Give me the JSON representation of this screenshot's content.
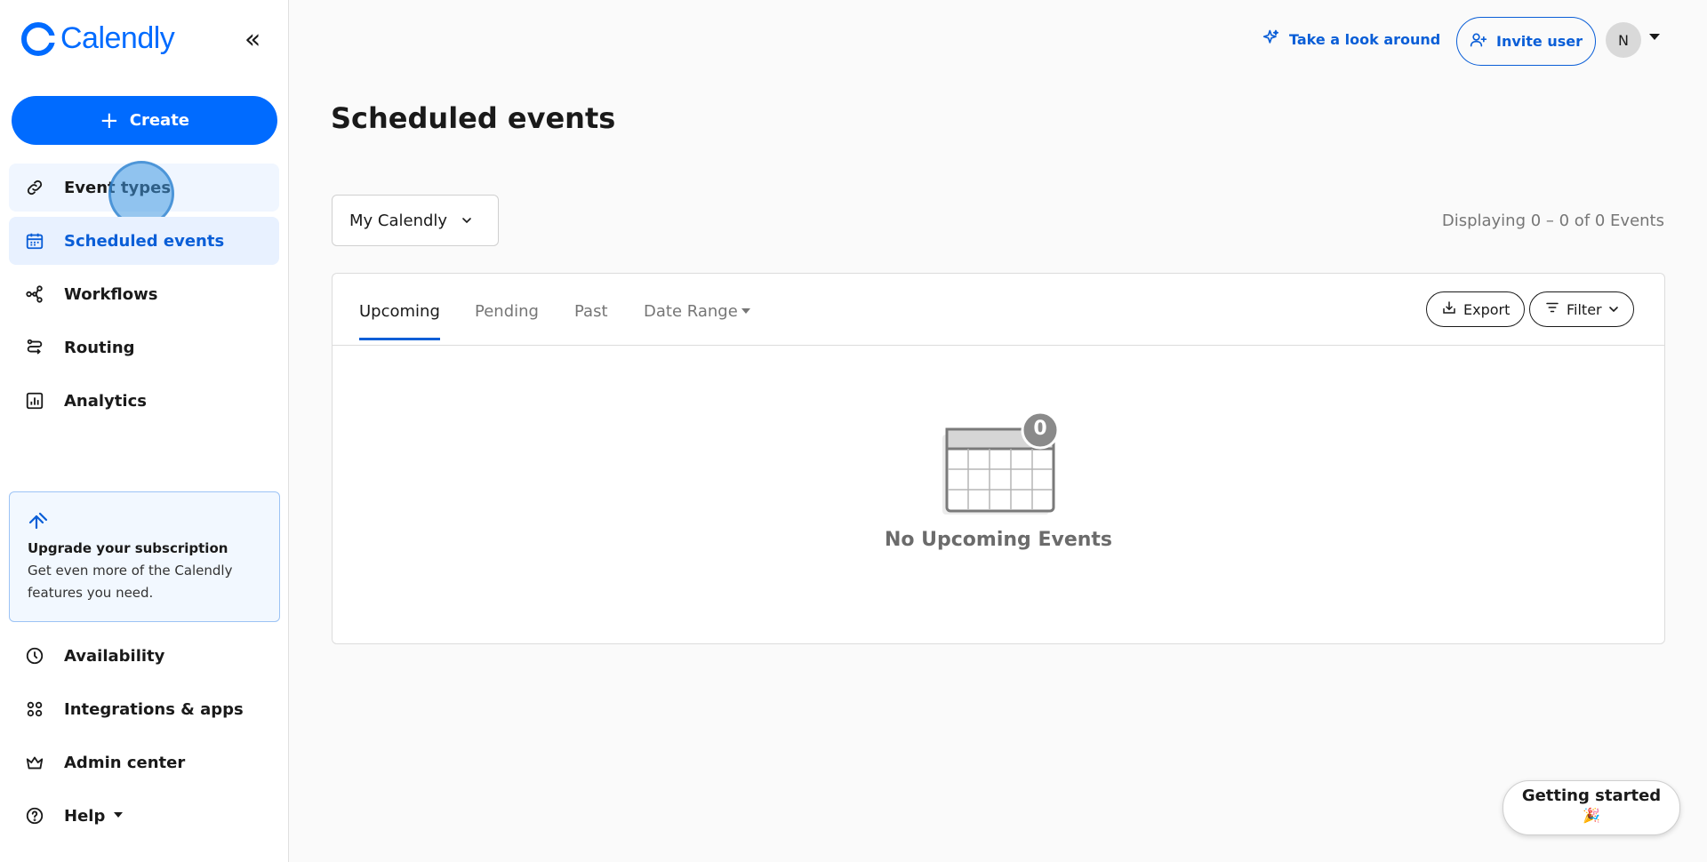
{
  "brand": {
    "name": "Calendly",
    "color": "#006bff"
  },
  "sidebar": {
    "collapse_icon": "double-chevron-left-icon",
    "create_label": "Create",
    "items": [
      {
        "label": "Event types",
        "icon": "link-icon"
      },
      {
        "label": "Scheduled events",
        "icon": "calendar-icon",
        "active": true
      },
      {
        "label": "Workflows",
        "icon": "workflow-icon"
      },
      {
        "label": "Routing",
        "icon": "routing-icon"
      },
      {
        "label": "Analytics",
        "icon": "analytics-icon"
      }
    ],
    "upgrade": {
      "icon": "upgrade-icon",
      "title": "Upgrade your subscription",
      "text": "Get even more of the Calendly features you need."
    },
    "bottom_items": [
      {
        "label": "Availability",
        "icon": "clock-icon"
      },
      {
        "label": "Integrations & apps",
        "icon": "apps-grid-icon"
      },
      {
        "label": "Admin center",
        "icon": "crown-icon"
      },
      {
        "label": "Help",
        "icon": "help-icon"
      }
    ]
  },
  "header": {
    "take_look_label": "Take a look around",
    "invite_label": "Invite user",
    "avatar_initial": "N"
  },
  "main": {
    "title": "Scheduled events",
    "calendar_select": "My Calendly",
    "displaying": "Displaying 0 – 0 of 0 Events",
    "tabs": [
      {
        "label": "Upcoming",
        "active": true
      },
      {
        "label": "Pending"
      },
      {
        "label": "Past"
      },
      {
        "label": "Date Range"
      }
    ],
    "export_label": "Export",
    "filter_label": "Filter",
    "empty": {
      "badge_count": "0",
      "text": "No Upcoming Events"
    }
  },
  "getting_started": {
    "label": "Getting started",
    "emoji": "🎉"
  }
}
